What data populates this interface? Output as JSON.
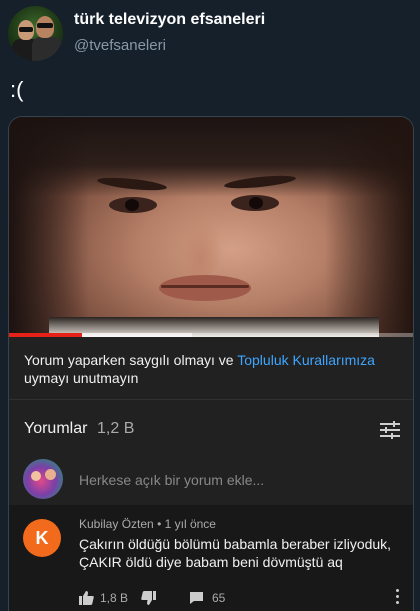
{
  "tweet": {
    "display_name": "türk televizyon efsaneleri",
    "handle": "@tvefsaneleri",
    "text": ":("
  },
  "video": {
    "progress": 0.18,
    "buffered": 0.45,
    "progress_color": "#e62117"
  },
  "notice": {
    "text_before": "Yorum yaparken saygılı olmayı ve ",
    "link": "Topluluk Kurallarımıza",
    "text_after": " uymayı unutmayın",
    "link_color": "#3ea6ff"
  },
  "comments": {
    "title": "Yorumlar",
    "count": "1,2 B",
    "sort_icon": "sort-filter-icon",
    "add_placeholder": "Herkese açık bir yorum ekle...",
    "items": [
      {
        "avatar_letter": "K",
        "avatar_color": "#f26a1c",
        "author": "Kubilay Özten",
        "time": "1 yıl önce",
        "body": "Çakırın öldüğü bölümü babamla beraber izliyoduk, ÇAKIR öldü diye babam beni dövmüştü aq",
        "likes": "1,8 B",
        "replies": "65"
      }
    ]
  }
}
